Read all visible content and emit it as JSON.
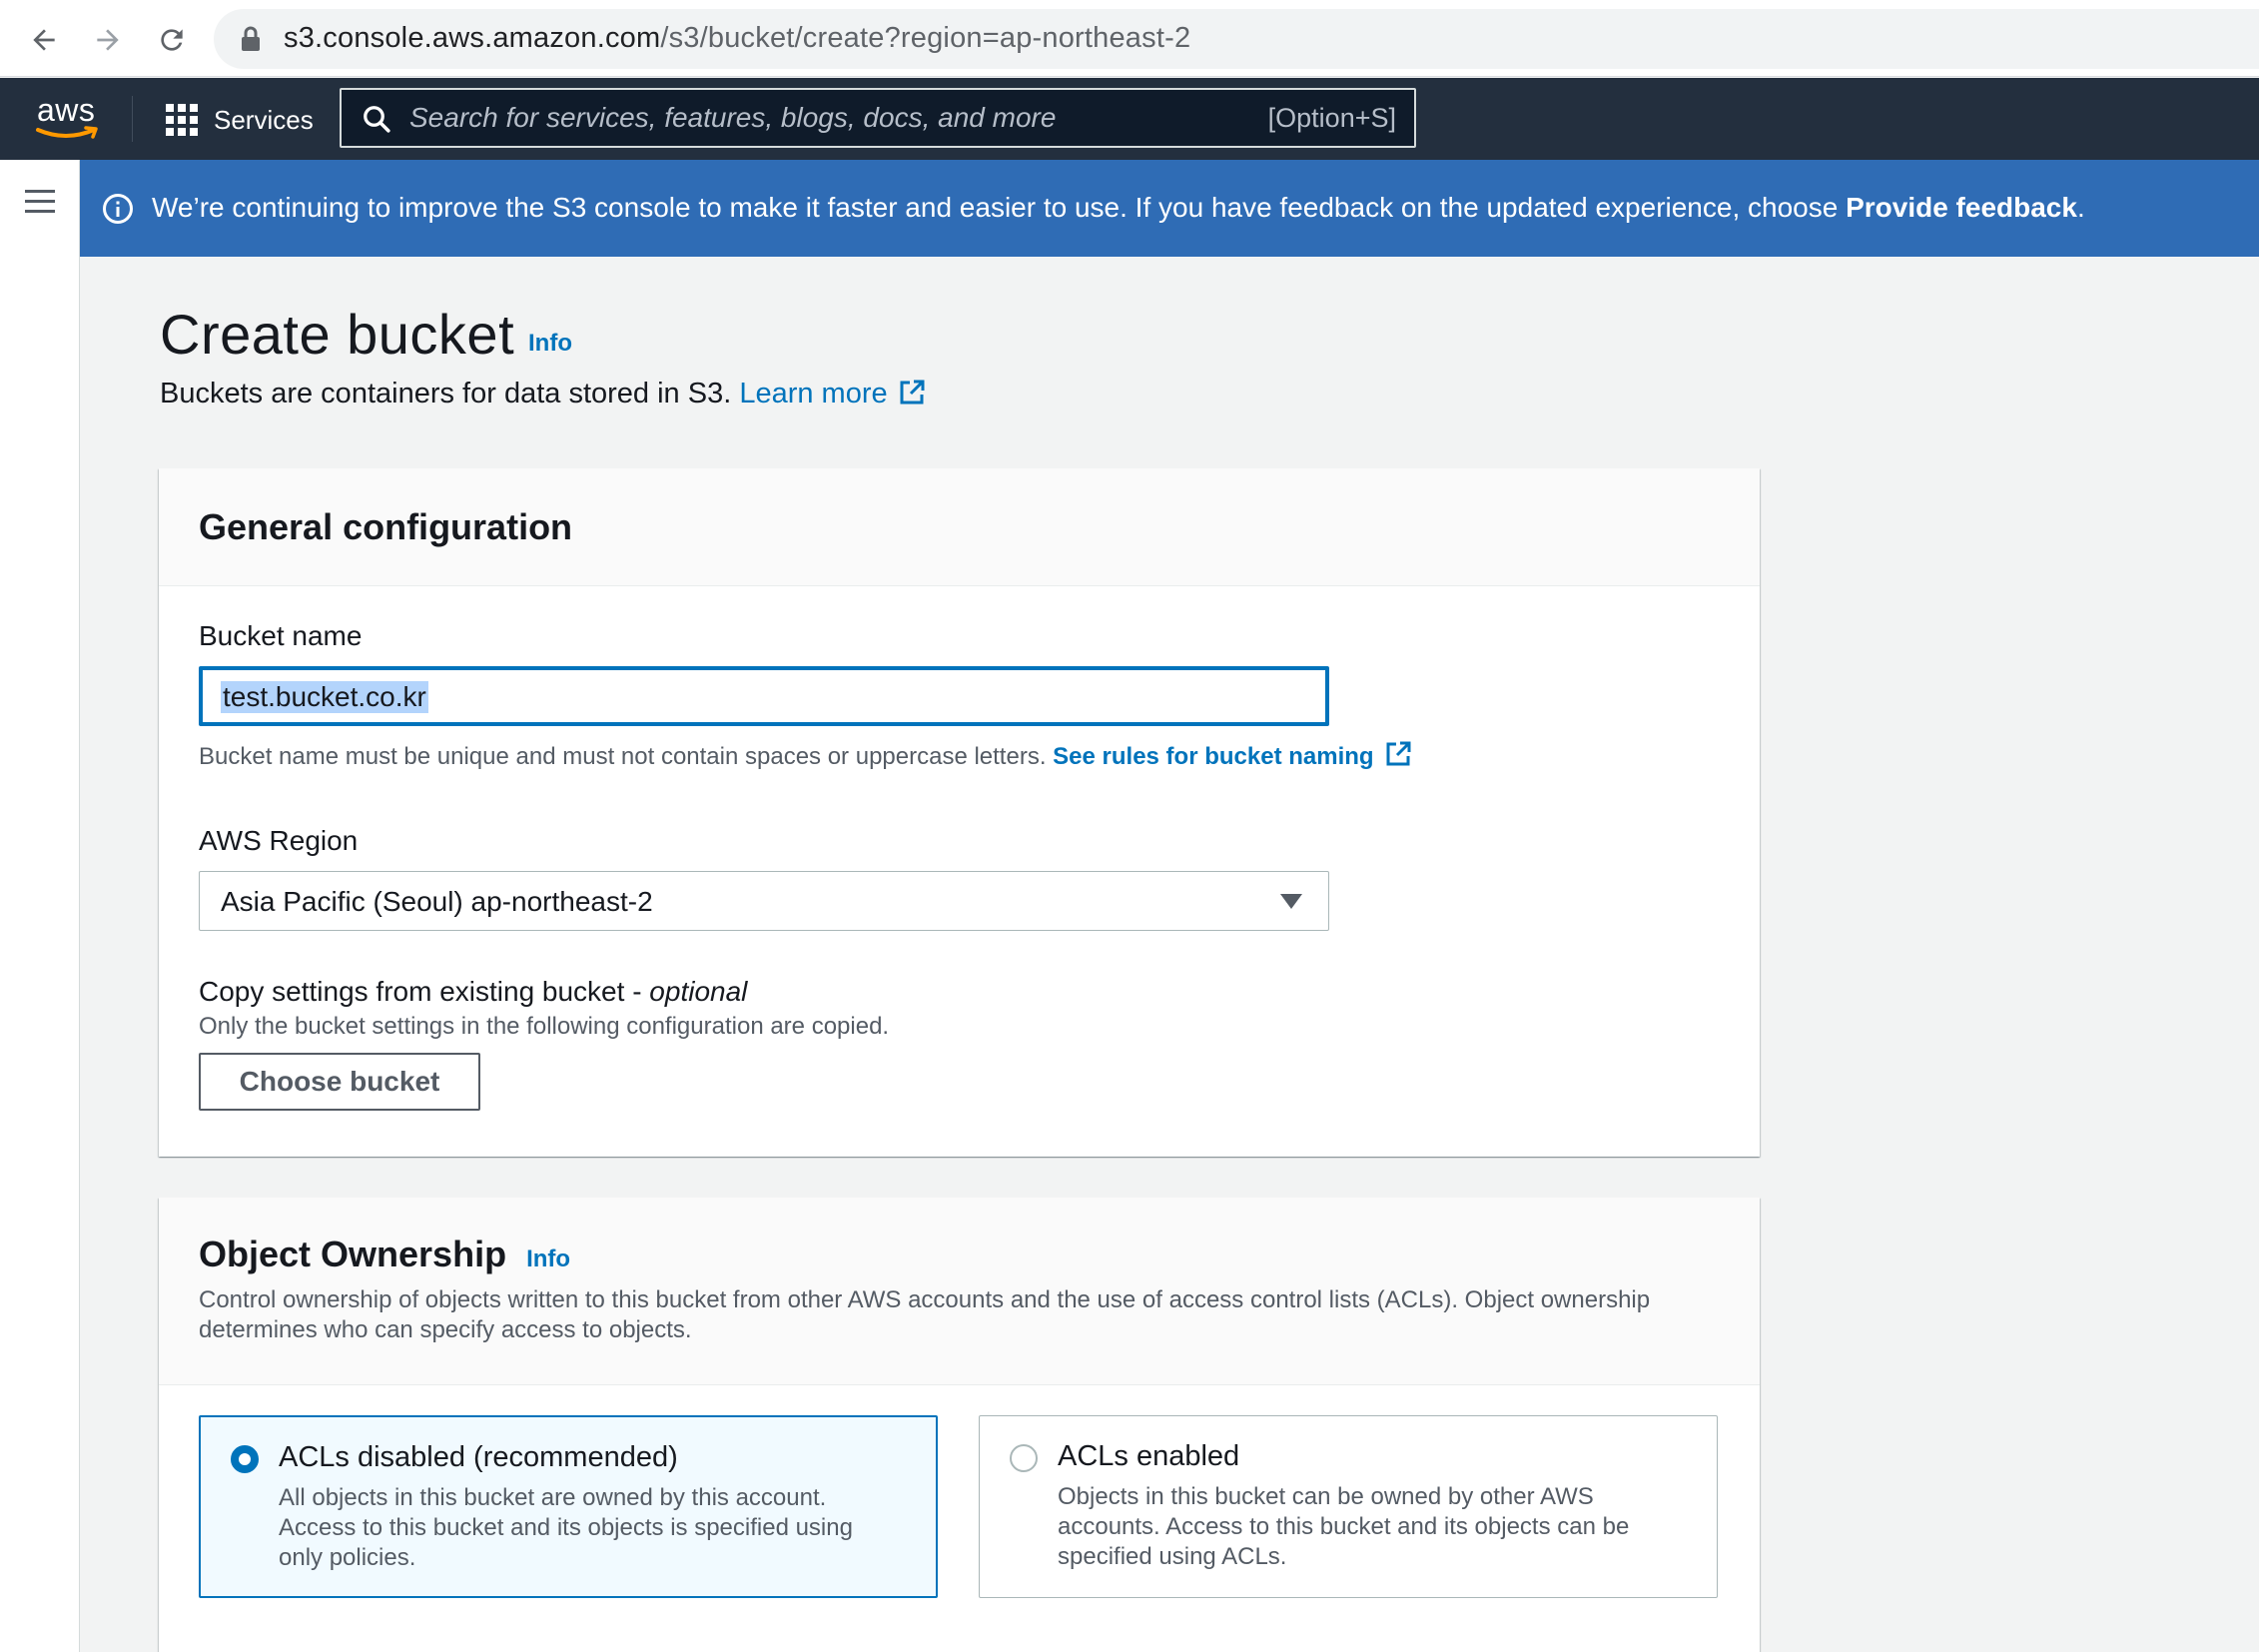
{
  "browser": {
    "url_host": "s3.console.aws.amazon.com",
    "url_path": "/s3/bucket/create?region=ap-northeast-2"
  },
  "aws_nav": {
    "logo_text": "aws",
    "services_label": "Services",
    "search_placeholder": "Search for services, features, blogs, docs, and more",
    "search_shortcut": "[Option+S]"
  },
  "flash": {
    "message": "We’re continuing to improve the S3 console to make it faster and easier to use. If you have feedback on the updated experience, choose ",
    "link_text": "Provide feedback",
    "suffix": "."
  },
  "page": {
    "title": "Create bucket",
    "info": "Info",
    "description": "Buckets are containers for data stored in S3. ",
    "learn_more": "Learn more"
  },
  "general_config": {
    "title": "General configuration",
    "bucket_name_label": "Bucket name",
    "bucket_name_value": "test.bucket.co.kr",
    "bucket_name_hint": "Bucket name must be unique and must not contain spaces or uppercase letters. ",
    "naming_rules_link": "See rules for bucket naming",
    "region_label": "AWS Region",
    "region_value": "Asia Pacific (Seoul) ap-northeast-2",
    "copy_label": "Copy settings from existing bucket - ",
    "copy_optional": "optional",
    "copy_hint": "Only the bucket settings in the following configuration are copied.",
    "choose_bucket": "Choose bucket"
  },
  "object_ownership": {
    "title": "Object Ownership",
    "info": "Info",
    "description": "Control ownership of objects written to this bucket from other AWS accounts and the use of access control lists (ACLs). Object ownership determines who can specify access to objects.",
    "options": [
      {
        "title": "ACLs disabled (recommended)",
        "description": "All objects in this bucket are owned by this account. Access to this bucket and its objects is specified using only policies.",
        "selected": true
      },
      {
        "title": "ACLs enabled",
        "description": "Objects in this bucket can be owned by other AWS accounts. Access to this bucket and its objects can be specified using ACLs.",
        "selected": false
      }
    ]
  },
  "colors": {
    "aws_nav_bg": "#232f3e",
    "flash_bg": "#2f6cb5",
    "link": "#0073bb",
    "aws_orange": "#ff9900"
  }
}
